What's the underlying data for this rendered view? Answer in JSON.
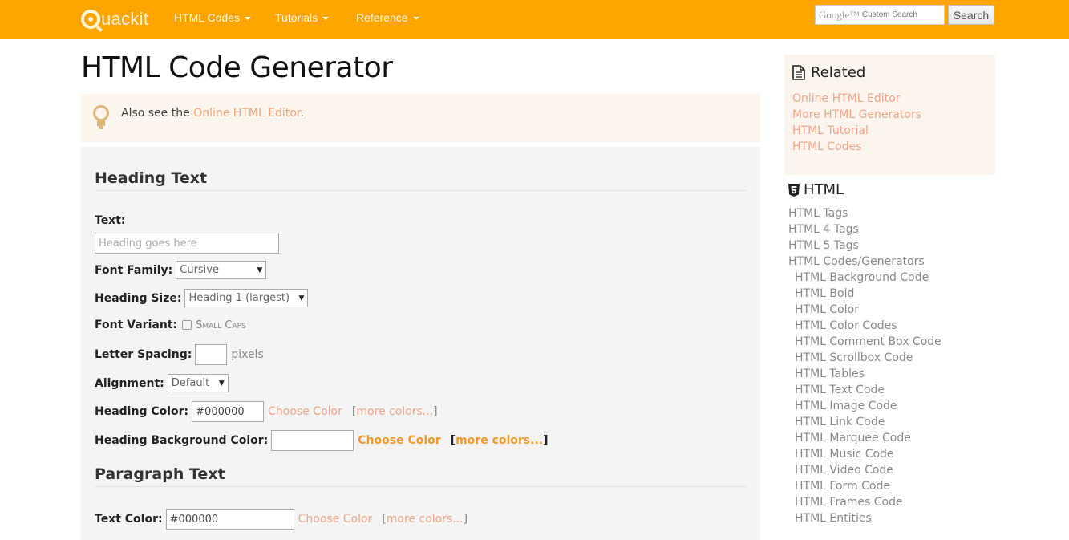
{
  "header": {
    "logo_text": "uackit",
    "nav": [
      {
        "label": "HTML Codes"
      },
      {
        "label": "Tutorials"
      },
      {
        "label": "Reference"
      }
    ],
    "search": {
      "placeholder_brand": "Google™",
      "placeholder_text": "Custom Search",
      "button_label": "Search"
    }
  },
  "main": {
    "title": "HTML Code Generator",
    "tip": {
      "prefix": "Also see the ",
      "link": "Online HTML Editor",
      "suffix": "."
    },
    "heading_section": {
      "title": "Heading Text",
      "text_label": "Text:",
      "text_placeholder": "Heading goes here",
      "font_family_label": "Font Family:",
      "font_family_value": "Cursive",
      "heading_size_label": "Heading Size:",
      "heading_size_value": "Heading 1 (largest)",
      "font_variant_label": "Font Variant:",
      "font_variant_option": "Small Caps",
      "letter_spacing_label": "Letter Spacing:",
      "letter_spacing_value": "",
      "letter_spacing_unit": "pixels",
      "alignment_label": "Alignment:",
      "alignment_value": "Default",
      "heading_color_label": "Heading Color:",
      "heading_color_value": "#000000",
      "choose_color": "Choose Color",
      "more_colors": "more colors...",
      "bg_color_label": "Heading Background Color:",
      "bg_color_value": ""
    },
    "paragraph_section": {
      "title": "Paragraph Text",
      "text_color_label": "Text Color:",
      "text_color_value": "#000000",
      "choose_color": "Choose Color",
      "more_colors": "more colors..."
    }
  },
  "sidebar": {
    "related": {
      "title": "Related",
      "links": [
        "Online HTML Editor",
        "More HTML Generators",
        "HTML Tutorial",
        "HTML Codes"
      ]
    },
    "html": {
      "title": "HTML",
      "items": [
        {
          "label": "HTML Tags",
          "level": 0
        },
        {
          "label": "HTML 4 Tags",
          "level": 0
        },
        {
          "label": "HTML 5 Tags",
          "level": 0
        },
        {
          "label": "HTML Codes/Generators",
          "level": 0
        },
        {
          "label": "HTML Background Code",
          "level": 1
        },
        {
          "label": "HTML Bold",
          "level": 1
        },
        {
          "label": "HTML Color",
          "level": 1
        },
        {
          "label": "HTML Color Codes",
          "level": 1
        },
        {
          "label": "HTML Comment Box Code",
          "level": 1
        },
        {
          "label": "HTML Scrollbox Code",
          "level": 1
        },
        {
          "label": "HTML Tables",
          "level": 1
        },
        {
          "label": "HTML Text Code",
          "level": 1
        },
        {
          "label": "HTML Image Code",
          "level": 1
        },
        {
          "label": "HTML Link Code",
          "level": 1
        },
        {
          "label": "HTML Marquee Code",
          "level": 1
        },
        {
          "label": "HTML Music Code",
          "level": 1
        },
        {
          "label": "HTML Video Code",
          "level": 1
        },
        {
          "label": "HTML Form Code",
          "level": 1
        },
        {
          "label": "HTML Frames Code",
          "level": 1
        },
        {
          "label": "HTML Entities",
          "level": 1
        }
      ]
    }
  },
  "colors": {
    "brand": "#ffa500",
    "link": "#f2a58a",
    "link_strong": "#f19a2c",
    "tip_bg": "#fbf5ee",
    "panel_bg": "#f4f4f4"
  }
}
